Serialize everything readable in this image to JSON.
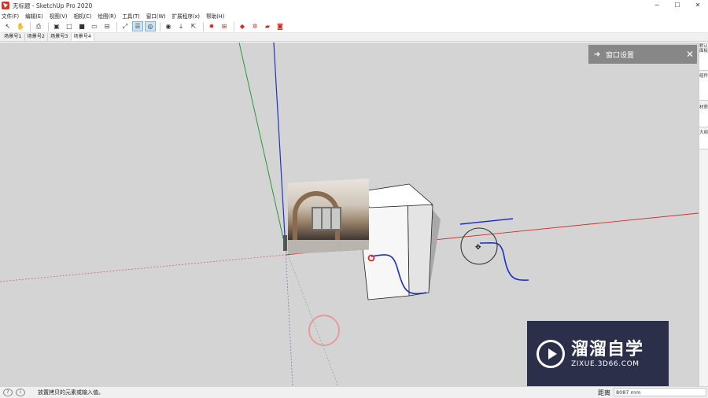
{
  "window": {
    "title": "无标题 - SketchUp Pro 2020",
    "minimize": "─",
    "maximize": "☐",
    "close": "✕"
  },
  "menu": [
    "文件(F)",
    "编辑(E)",
    "视图(V)",
    "相机(C)",
    "绘图(R)",
    "工具(T)",
    "窗口(W)",
    "扩展程序(x)",
    "帮助(H)"
  ],
  "toolbar": {
    "icons": [
      "select-icon",
      "pan-icon",
      "print-icon",
      "iso-view-icon",
      "top-view-icon",
      "front-view-icon",
      "right-view-icon",
      "back-view-icon",
      "left-view-icon",
      "xray-icon",
      "layers-icon",
      "section-icon",
      "orbit-icon",
      "tape-icon",
      "push-icon",
      "gear-sun-icon",
      "components-icon",
      "ruby-icon",
      "extension-gear-icon",
      "folder-icon",
      "camera-icon"
    ]
  },
  "scenes": [
    "场景号1",
    "场景号2",
    "场景号3",
    "场景号4"
  ],
  "active_scene": "场景号4",
  "tray": {
    "title": "窗口设置"
  },
  "dock_tabs": [
    "默认面板",
    "组件",
    "材质",
    "大纲"
  ],
  "status": {
    "message": "放置拷贝的元素或输入值。",
    "measure_label": "距离",
    "measure_value": "8087 mm"
  },
  "watermark": {
    "brand": "溜溜自学",
    "url": "ZIXUE.3D66.COM"
  },
  "colors": {
    "viewport_bg": "#d4d4d4",
    "axis_red": "#d0302a",
    "axis_green": "#2a9a3a",
    "axis_blue": "#2233bb",
    "curve_blue": "#1a2fc0",
    "tray_bg": "#878787"
  }
}
